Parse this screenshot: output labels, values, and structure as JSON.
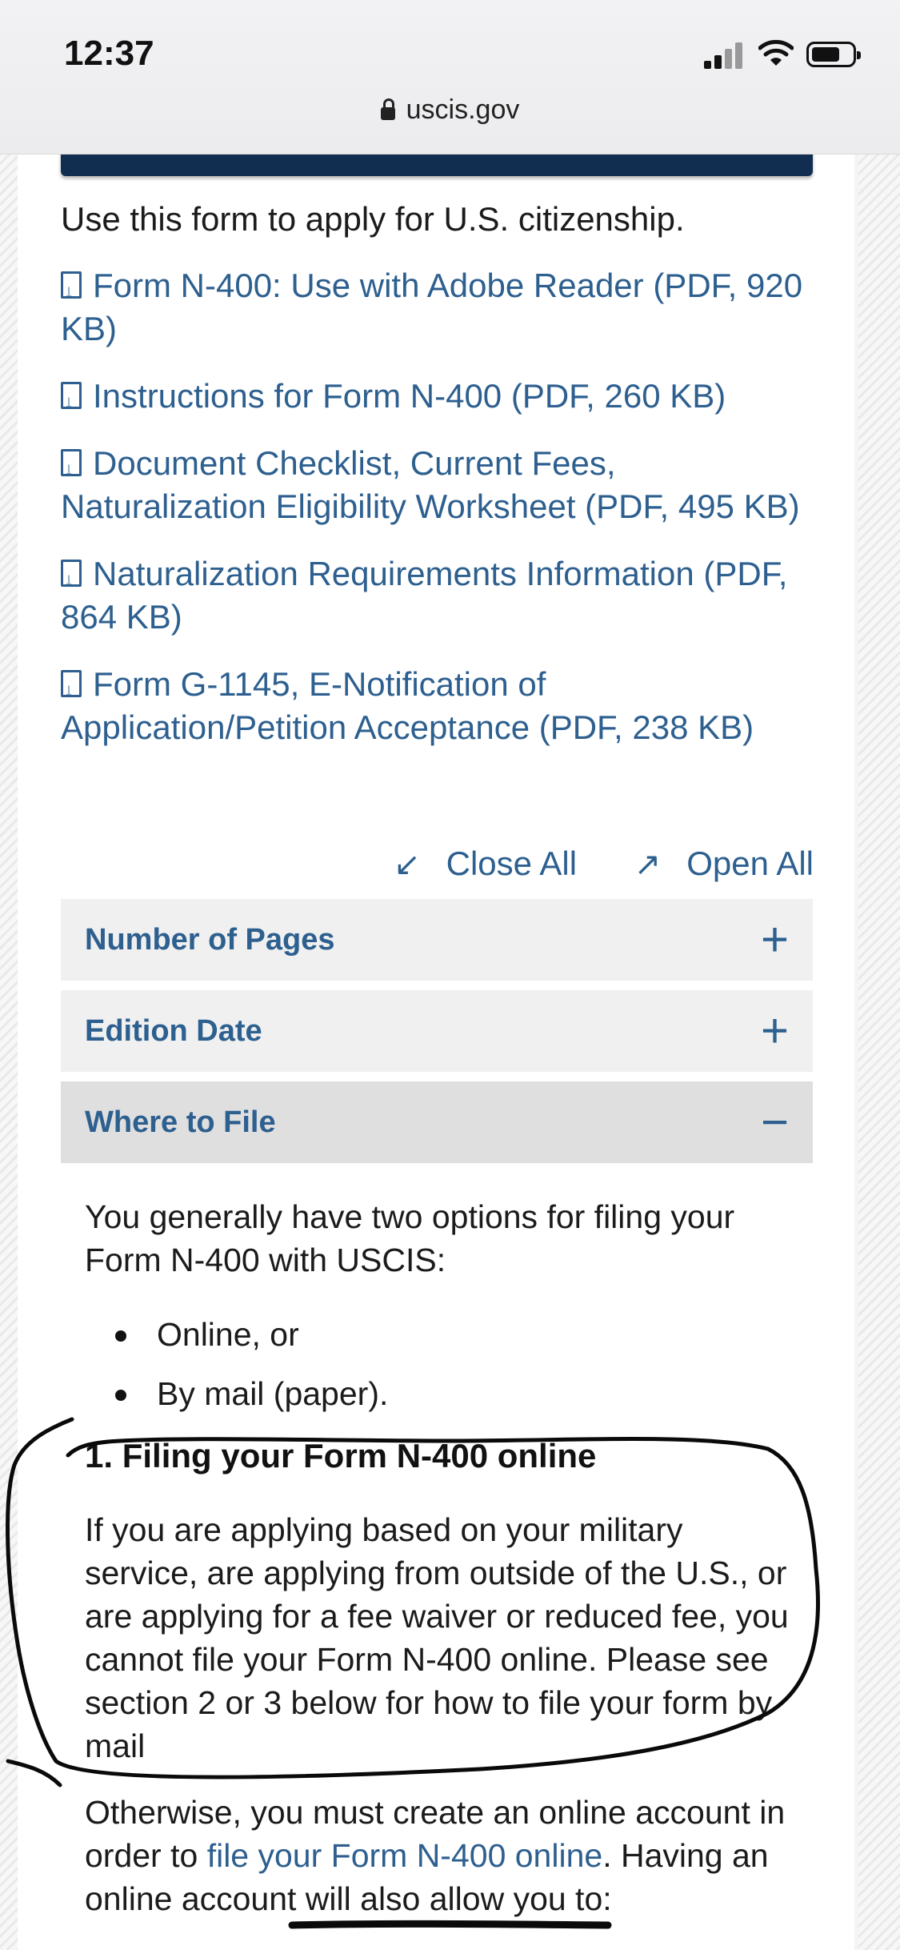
{
  "status_bar": {
    "time": "12:37"
  },
  "browser": {
    "url": "uscis.gov"
  },
  "intro_text": "Use this form to apply for U.S. citizenship.",
  "downloads": [
    {
      "label": "Form N-400: Use with Adobe Reader (PDF, 920 KB)"
    },
    {
      "label": "Instructions for Form N-400 (PDF, 260 KB)"
    },
    {
      "label": "Document Checklist, Current Fees, Naturalization Eligibility Worksheet (PDF, 495 KB)"
    },
    {
      "label": "Naturalization Requirements Information (PDF, 864 KB)"
    },
    {
      "label": "Form G-1145, E-Notification of Application/Petition Acceptance (PDF, 238 KB)"
    }
  ],
  "controls": {
    "close_all": "Close All",
    "open_all": "Open All"
  },
  "accordions": [
    {
      "title": "Number of Pages",
      "sign": "+"
    },
    {
      "title": "Edition Date",
      "sign": "+"
    },
    {
      "title": "Where to File",
      "sign": "−"
    }
  ],
  "where_to_file": {
    "intro": "You generally have two options for filing your Form N-400 with USCIS:",
    "options": [
      "Online, or",
      "By mail (paper)."
    ],
    "section1_heading": "1. Filing your Form N-400 online",
    "section1_text": "If you are applying based on your military service, are applying from outside of the U.S., or are applying for a fee waiver or reduced fee, you cannot file your Form N-400 online. Please see section 2 or 3 below for how to file your form by mail",
    "otherwise_prefix": "Otherwise, you must create an online account in order to ",
    "otherwise_link": "file your Form N-400 online",
    "otherwise_suffix": ". Having an online account will also allow you to:"
  }
}
